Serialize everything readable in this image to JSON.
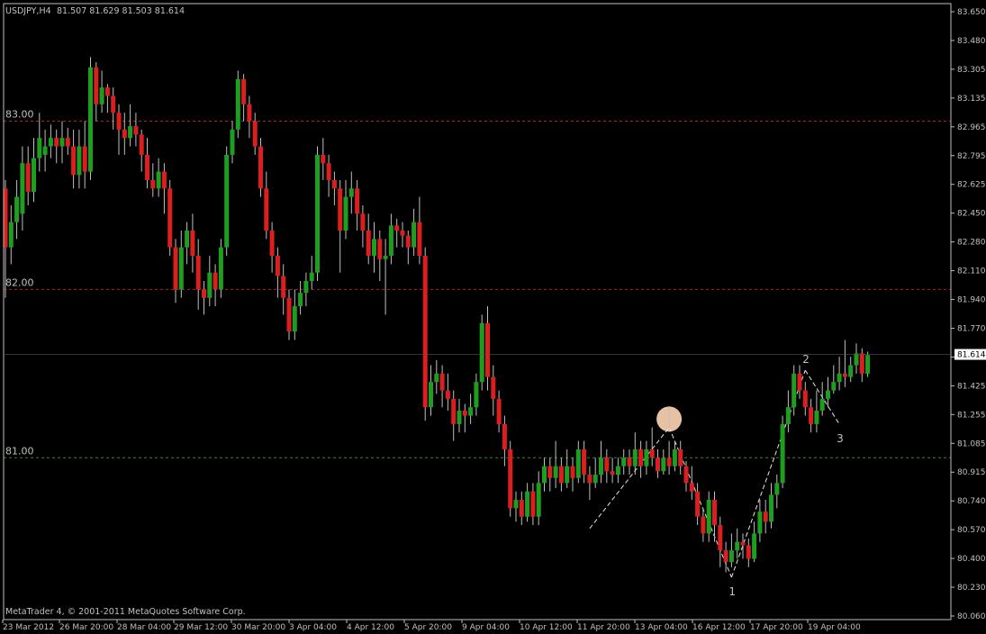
{
  "header": {
    "symbol": "USDJPY,H4",
    "ohlc": "81.507 81.629 81.503 81.614"
  },
  "footer": {
    "copyright": "MetaTrader 4, © 2001-2011 MetaQuotes Software Corp."
  },
  "colors": {
    "background": "#000000",
    "bull_candle": "#1e9e1e",
    "bear_candle": "#dc1e1e",
    "wick": "#bfbfbf",
    "axis": "#c0c0c0",
    "resistance_line": "#b22222",
    "support_line": "#2e8b2e",
    "pattern_line": "#e6e6e6",
    "highlight_marker": "#ffd7b4",
    "current_price_label_bg": "#ffffff"
  },
  "chart_data": {
    "type": "candlestick",
    "ylim": [
      80.06,
      83.65
    ],
    "y_ticks": [
      "83.650",
      "83.480",
      "83.305",
      "83.135",
      "82.965",
      "82.795",
      "82.625",
      "82.450",
      "82.280",
      "82.110",
      "81.940",
      "81.770",
      "81.595",
      "81.425",
      "81.255",
      "81.085",
      "80.915",
      "80.740",
      "80.570",
      "80.400",
      "80.230",
      "80.060"
    ],
    "x_labels": [
      "23 Mar 2012",
      "26 Mar 20:00",
      "28 Mar 04:00",
      "29 Mar 12:00",
      "30 Mar 20:00",
      "3 Apr 04:00",
      "4 Apr 12:00",
      "5 Apr 20:00",
      "9 Apr 04:00",
      "10 Apr 12:00",
      "11 Apr 20:00",
      "13 Apr 04:00",
      "16 Apr 12:00",
      "17 Apr 20:00",
      "19 Apr 04:00"
    ],
    "current_price": "81.614",
    "levels": [
      {
        "label": "83.00",
        "value": 83.0,
        "kind": "resistance"
      },
      {
        "label": "82.00",
        "value": 82.0,
        "kind": "resistance"
      },
      {
        "label": "81.00",
        "value": 81.0,
        "kind": "support"
      }
    ],
    "pattern_points": [
      {
        "label": "",
        "bar": 103,
        "value": 80.58
      },
      {
        "label": "",
        "bar": 117,
        "value": 81.18
      },
      {
        "label": "1",
        "bar": 128,
        "value": 80.29
      },
      {
        "label": "2",
        "bar": 141,
        "value": 81.52
      },
      {
        "label": "3",
        "bar": 147,
        "value": 81.2
      }
    ],
    "pattern_labels_shown": [
      "1",
      "2",
      "3"
    ],
    "highlight_bar": 117,
    "highlight_value": 81.23,
    "candles": [
      [
        82.6,
        82.25,
        82.65,
        81.95
      ],
      [
        82.25,
        82.4,
        82.5,
        82.15
      ],
      [
        82.4,
        82.55,
        82.65,
        82.3
      ],
      [
        82.45,
        82.75,
        82.85,
        82.35
      ],
      [
        82.75,
        82.58,
        82.85,
        82.5
      ],
      [
        82.58,
        82.78,
        82.9,
        82.52
      ],
      [
        82.78,
        82.9,
        83.05,
        82.7
      ],
      [
        82.8,
        82.85,
        82.95,
        82.7
      ],
      [
        82.85,
        82.9,
        82.98,
        82.78
      ],
      [
        82.9,
        82.85,
        82.95,
        82.75
      ],
      [
        82.85,
        82.9,
        83.0,
        82.75
      ],
      [
        82.9,
        82.85,
        82.96,
        82.8
      ],
      [
        82.85,
        82.68,
        82.95,
        82.6
      ],
      [
        82.68,
        82.85,
        82.95,
        82.6
      ],
      [
        82.85,
        82.7,
        83.0,
        82.6
      ],
      [
        82.7,
        83.32,
        83.38,
        82.65
      ],
      [
        83.32,
        83.1,
        83.35,
        83.0
      ],
      [
        83.1,
        83.2,
        83.3,
        83.05
      ],
      [
        83.2,
        83.15,
        83.22,
        83.05
      ],
      [
        83.15,
        83.05,
        83.2,
        82.95
      ],
      [
        83.05,
        82.95,
        83.1,
        82.8
      ],
      [
        82.95,
        82.9,
        83.05,
        82.8
      ],
      [
        82.9,
        82.97,
        83.1,
        82.85
      ],
      [
        82.97,
        82.92,
        83.05,
        82.85
      ],
      [
        82.92,
        82.8,
        82.95,
        82.7
      ],
      [
        82.8,
        82.65,
        82.9,
        82.6
      ],
      [
        82.65,
        82.6,
        82.75,
        82.55
      ],
      [
        82.6,
        82.7,
        82.78,
        82.55
      ],
      [
        82.7,
        82.6,
        82.75,
        82.45
      ],
      [
        82.6,
        82.25,
        82.65,
        82.2
      ],
      [
        82.25,
        82.0,
        82.3,
        81.92
      ],
      [
        82.0,
        82.25,
        82.35,
        81.95
      ],
      [
        82.25,
        82.35,
        82.4,
        82.15
      ],
      [
        82.35,
        82.2,
        82.45,
        82.1
      ],
      [
        82.2,
        82.0,
        82.3,
        81.88
      ],
      [
        82.0,
        81.95,
        82.05,
        81.85
      ],
      [
        81.95,
        82.1,
        82.2,
        81.9
      ],
      [
        82.1,
        82.0,
        82.15,
        81.9
      ],
      [
        82.0,
        82.25,
        82.3,
        81.95
      ],
      [
        82.25,
        82.8,
        82.85,
        82.2
      ],
      [
        82.8,
        82.95,
        83.0,
        82.75
      ],
      [
        82.95,
        83.25,
        83.3,
        82.9
      ],
      [
        83.25,
        83.1,
        83.28,
        83.0
      ],
      [
        83.1,
        83.0,
        83.15,
        82.9
      ],
      [
        83.0,
        82.85,
        83.05,
        82.8
      ],
      [
        82.85,
        82.6,
        82.9,
        82.55
      ],
      [
        82.6,
        82.35,
        82.7,
        82.3
      ],
      [
        82.35,
        82.2,
        82.4,
        82.1
      ],
      [
        82.2,
        82.08,
        82.25,
        81.95
      ],
      [
        82.08,
        81.95,
        82.15,
        81.85
      ],
      [
        81.95,
        81.75,
        82.0,
        81.7
      ],
      [
        81.75,
        81.9,
        82.0,
        81.7
      ],
      [
        81.9,
        81.98,
        82.05,
        81.85
      ],
      [
        81.98,
        82.05,
        82.1,
        81.9
      ],
      [
        82.05,
        82.1,
        82.2,
        82.0
      ],
      [
        82.1,
        82.8,
        82.85,
        82.05
      ],
      [
        82.8,
        82.75,
        82.9,
        82.65
      ],
      [
        82.75,
        82.65,
        82.8,
        82.55
      ],
      [
        82.65,
        82.6,
        82.7,
        82.5
      ],
      [
        82.6,
        82.35,
        82.65,
        82.1
      ],
      [
        82.35,
        82.55,
        82.65,
        82.3
      ],
      [
        82.55,
        82.6,
        82.7,
        82.45
      ],
      [
        82.6,
        82.45,
        82.65,
        82.35
      ],
      [
        82.45,
        82.35,
        82.5,
        82.25
      ],
      [
        82.35,
        82.2,
        82.45,
        82.15
      ],
      [
        82.2,
        82.3,
        82.4,
        82.1
      ],
      [
        82.3,
        82.18,
        82.35,
        82.05
      ],
      [
        82.18,
        82.2,
        82.3,
        81.85
      ],
      [
        82.2,
        82.38,
        82.45,
        82.15
      ],
      [
        82.38,
        82.35,
        82.42,
        82.25
      ],
      [
        82.35,
        82.32,
        82.4,
        82.25
      ],
      [
        82.32,
        82.25,
        82.35,
        82.15
      ],
      [
        82.25,
        82.4,
        82.48,
        82.2
      ],
      [
        82.4,
        82.2,
        82.55,
        82.15
      ],
      [
        82.2,
        81.3,
        82.25,
        81.22
      ],
      [
        81.3,
        81.45,
        81.55,
        81.25
      ],
      [
        81.45,
        81.5,
        81.58,
        81.38
      ],
      [
        81.5,
        81.4,
        81.55,
        81.3
      ],
      [
        81.4,
        81.35,
        81.5,
        81.28
      ],
      [
        81.35,
        81.2,
        81.4,
        81.1
      ],
      [
        81.2,
        81.28,
        81.35,
        81.15
      ],
      [
        81.28,
        81.25,
        81.32,
        81.15
      ],
      [
        81.25,
        81.3,
        81.38,
        81.2
      ],
      [
        81.3,
        81.45,
        81.5,
        81.25
      ],
      [
        81.45,
        81.8,
        81.85,
        81.4
      ],
      [
        81.8,
        81.48,
        81.9,
        81.4
      ],
      [
        81.48,
        81.35,
        81.55,
        81.25
      ],
      [
        81.35,
        81.2,
        81.4,
        81.15
      ],
      [
        81.2,
        81.05,
        81.25,
        80.95
      ],
      [
        81.05,
        80.7,
        81.1,
        80.65
      ],
      [
        80.7,
        80.75,
        80.8,
        80.62
      ],
      [
        80.75,
        80.65,
        80.8,
        80.6
      ],
      [
        80.65,
        80.8,
        80.85,
        80.62
      ],
      [
        80.8,
        80.65,
        80.85,
        80.6
      ],
      [
        80.65,
        80.85,
        80.92,
        80.6
      ],
      [
        80.85,
        80.95,
        81.0,
        80.8
      ],
      [
        80.95,
        80.88,
        81.0,
        80.8
      ],
      [
        80.88,
        80.95,
        81.1,
        80.82
      ],
      [
        80.95,
        80.85,
        81.0,
        80.8
      ],
      [
        80.85,
        80.95,
        81.05,
        80.82
      ],
      [
        80.95,
        80.88,
        81.0,
        80.8
      ],
      [
        80.88,
        81.05,
        81.1,
        80.85
      ],
      [
        81.05,
        80.9,
        81.1,
        80.85
      ],
      [
        80.9,
        80.85,
        80.95,
        80.75
      ],
      [
        80.85,
        80.9,
        81.0,
        80.82
      ],
      [
        80.9,
        81.0,
        81.1,
        80.85
      ],
      [
        81.0,
        80.92,
        81.05,
        80.85
      ],
      [
        80.92,
        80.9,
        81.0,
        80.85
      ],
      [
        80.9,
        80.95,
        81.0,
        80.85
      ],
      [
        80.95,
        81.0,
        81.05,
        80.9
      ],
      [
        81.0,
        80.95,
        81.05,
        80.9
      ],
      [
        80.95,
        81.05,
        81.15,
        80.9
      ],
      [
        81.05,
        80.95,
        81.1,
        80.88
      ],
      [
        80.95,
        81.05,
        81.1,
        80.9
      ],
      [
        81.05,
        81.0,
        81.18,
        80.95
      ],
      [
        81.0,
        80.92,
        81.05,
        80.88
      ],
      [
        80.92,
        81.0,
        81.05,
        80.9
      ],
      [
        81.0,
        80.95,
        81.1,
        80.9
      ],
      [
        80.95,
        81.05,
        81.1,
        80.92
      ],
      [
        81.05,
        80.95,
        81.1,
        80.9
      ],
      [
        80.95,
        80.85,
        80.98,
        80.8
      ],
      [
        80.85,
        80.8,
        80.95,
        80.75
      ],
      [
        80.8,
        80.65,
        80.85,
        80.6
      ],
      [
        80.65,
        80.55,
        80.7,
        80.5
      ],
      [
        80.55,
        80.75,
        80.8,
        80.5
      ],
      [
        80.75,
        80.6,
        80.8,
        80.5
      ],
      [
        80.6,
        80.45,
        80.65,
        80.35
      ],
      [
        80.45,
        80.38,
        80.5,
        80.32
      ],
      [
        80.38,
        80.45,
        80.55,
        80.35
      ],
      [
        80.45,
        80.5,
        80.58,
        80.4
      ],
      [
        80.5,
        80.48,
        80.55,
        80.4
      ],
      [
        80.48,
        80.4,
        80.52,
        80.35
      ],
      [
        80.4,
        80.55,
        80.62,
        80.38
      ],
      [
        80.55,
        80.68,
        80.75,
        80.5
      ],
      [
        80.68,
        80.62,
        80.75,
        80.55
      ],
      [
        80.62,
        80.78,
        80.85,
        80.58
      ],
      [
        80.78,
        80.85,
        80.9,
        80.7
      ],
      [
        80.85,
        81.2,
        81.25,
        80.82
      ],
      [
        81.2,
        81.3,
        81.4,
        81.15
      ],
      [
        81.3,
        81.5,
        81.55,
        81.25
      ],
      [
        81.5,
        81.4,
        81.55,
        81.35
      ],
      [
        81.4,
        81.3,
        81.45,
        81.25
      ],
      [
        81.3,
        81.2,
        81.35,
        81.15
      ],
      [
        81.2,
        81.28,
        81.4,
        81.15
      ],
      [
        81.28,
        81.35,
        81.45,
        81.25
      ],
      [
        81.35,
        81.4,
        81.48,
        81.3
      ],
      [
        81.4,
        81.45,
        81.55,
        81.38
      ],
      [
        81.45,
        81.5,
        81.6,
        81.4
      ],
      [
        81.5,
        81.48,
        81.7,
        81.42
      ],
      [
        81.48,
        81.55,
        81.6,
        81.45
      ],
      [
        81.55,
        81.62,
        81.68,
        81.5
      ],
      [
        81.62,
        81.5,
        81.65,
        81.45
      ],
      [
        81.5,
        81.61,
        81.63,
        81.48
      ]
    ]
  }
}
